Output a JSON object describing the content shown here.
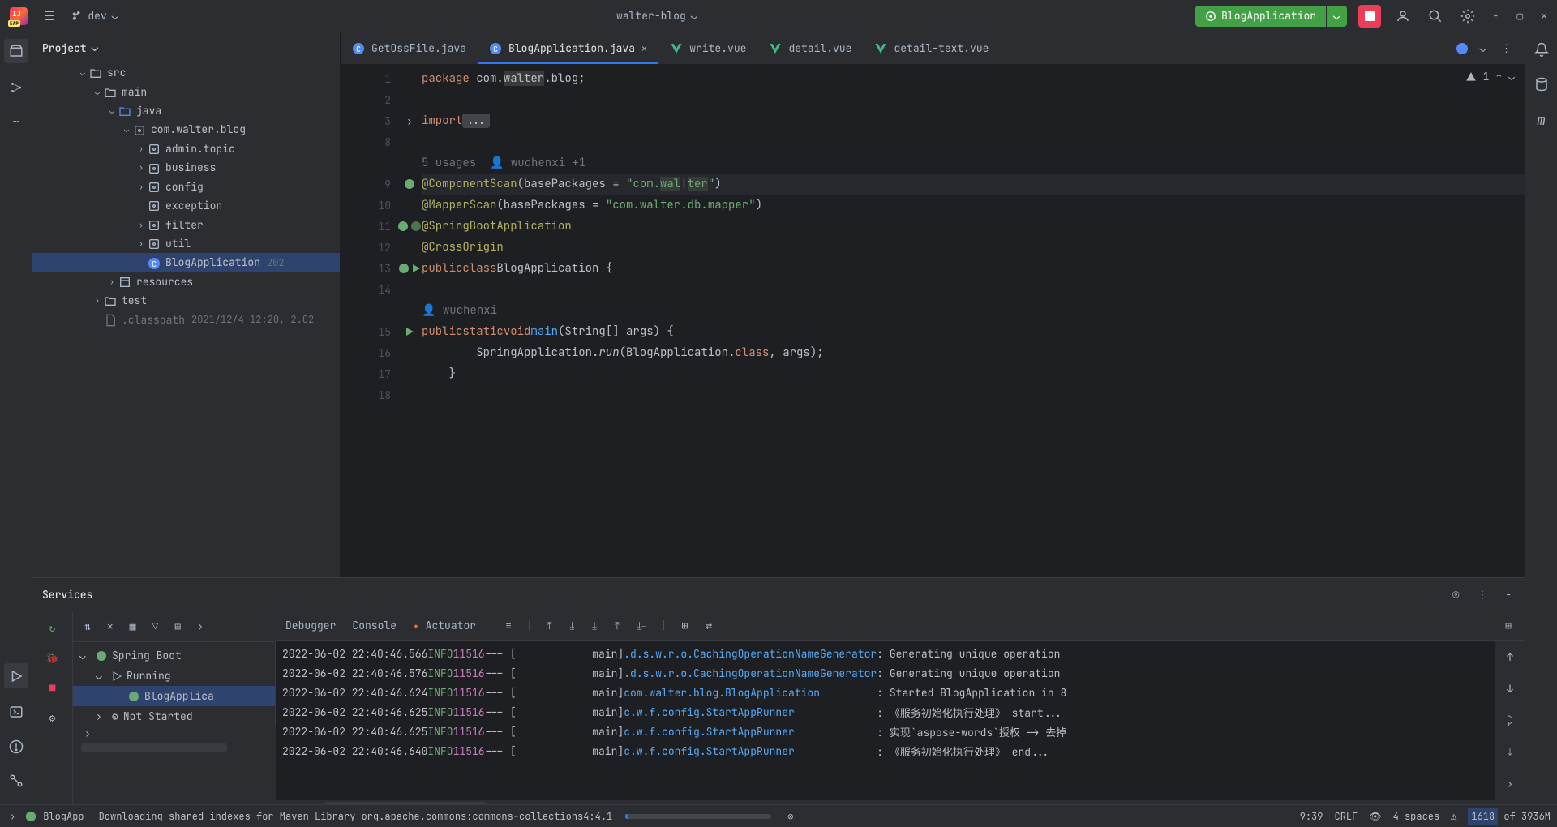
{
  "titlebar": {
    "branch": "dev",
    "project": "walter-blog",
    "run_config": "BlogApplication"
  },
  "project_panel": {
    "title": "Project",
    "tree": [
      {
        "indent": 3,
        "chevron": "v",
        "icon": "folder",
        "label": "src"
      },
      {
        "indent": 4,
        "chevron": "v",
        "icon": "folder",
        "label": "main"
      },
      {
        "indent": 5,
        "chevron": "v",
        "icon": "folder-blue",
        "label": "java"
      },
      {
        "indent": 6,
        "chevron": "v",
        "icon": "package",
        "label": "com.walter.blog"
      },
      {
        "indent": 7,
        "chevron": ">",
        "icon": "package",
        "label": "admin.topic"
      },
      {
        "indent": 7,
        "chevron": ">",
        "icon": "package",
        "label": "business"
      },
      {
        "indent": 7,
        "chevron": ">",
        "icon": "package",
        "label": "config"
      },
      {
        "indent": 7,
        "chevron": "",
        "icon": "package",
        "label": "exception"
      },
      {
        "indent": 7,
        "chevron": ">",
        "icon": "package",
        "label": "filter"
      },
      {
        "indent": 7,
        "chevron": ">",
        "icon": "package",
        "label": "util"
      },
      {
        "indent": 7,
        "chevron": "",
        "icon": "class",
        "label": "BlogApplication",
        "meta": "202",
        "selected": true
      },
      {
        "indent": 5,
        "chevron": ">",
        "icon": "resources",
        "label": "resources"
      },
      {
        "indent": 4,
        "chevron": ">",
        "icon": "folder",
        "label": "test"
      },
      {
        "indent": 4,
        "chevron": "",
        "icon": "file",
        "label": ".classpath",
        "meta": "2021/12/4 12:20, 2.02",
        "dimmed": true
      }
    ]
  },
  "tabs": [
    {
      "icon": "java",
      "label": "GetOssFile.java"
    },
    {
      "icon": "java",
      "label": "BlogApplication.java",
      "active": true,
      "closable": true
    },
    {
      "icon": "vue",
      "label": "write.vue"
    },
    {
      "icon": "vue",
      "label": "detail.vue"
    },
    {
      "icon": "vue",
      "label": "detail-text.vue"
    }
  ],
  "editor": {
    "inspection_count": "1",
    "lines": [
      {
        "num": "1",
        "html": "<span class='k-keyword'>package</span> com.<span class='highlight'>walter</span>.blog;"
      },
      {
        "num": "2",
        "html": ""
      },
      {
        "num": "3",
        "fold": ">",
        "html": "<span class='k-keyword'>import</span> <span class='k-fold'>...</span>"
      },
      {
        "num": "8",
        "html": ""
      },
      {
        "num": "",
        "html": "<span class='k-comment'>5 usages  👤 wuchenxi +1</span>"
      },
      {
        "num": "9",
        "icon": "spring",
        "caret": true,
        "html": "<span class='k-annotation'>@ComponentScan</span>(basePackages = <span class='k-string'>\"com.<span class='highlight'>wal</span>|<span class='highlight'>ter</span>\"</span>)"
      },
      {
        "num": "10",
        "html": "<span class='k-annotation'>@MapperScan</span>(basePackages = <span class='k-string'>\"com.walter.db.mapper\"</span>)"
      },
      {
        "num": "11",
        "icon": "spring2",
        "html": "<span class='k-annotation'>@SpringBootApplication</span>"
      },
      {
        "num": "12",
        "html": "<span class='k-annotation'>@CrossOrigin</span>"
      },
      {
        "num": "13",
        "icon": "run",
        "html": "<span class='k-keyword'>public</span> <span class='k-keyword'>class</span> <span class='k-class'>BlogApplication</span> {"
      },
      {
        "num": "14",
        "html": ""
      },
      {
        "num": "",
        "html": "    <span class='k-comment'>👤 wuchenxi</span>"
      },
      {
        "num": "15",
        "icon": "run-only",
        "html": "    <span class='k-keyword'>public</span> <span class='k-keyword'>static</span> <span class='k-keyword'>void</span> <span class='k-method'>main</span>(String[] args) {"
      },
      {
        "num": "16",
        "html": "        SpringApplication.<span class='k-italic'>run</span>(BlogApplication.<span class='k-keyword'>class</span>, args);"
      },
      {
        "num": "17",
        "html": "    }"
      },
      {
        "num": "18",
        "html": ""
      }
    ]
  },
  "services": {
    "title": "Services",
    "tree": [
      {
        "indent": 0,
        "chevron": "v",
        "icon": "spring",
        "label": "Spring Boot"
      },
      {
        "indent": 1,
        "chevron": "v",
        "icon": "run",
        "label": "Running"
      },
      {
        "indent": 2,
        "chevron": "",
        "icon": "app",
        "label": "BlogApplica",
        "selected": true
      },
      {
        "indent": 1,
        "chevron": ">",
        "icon": "gear",
        "label": "Not Started"
      }
    ],
    "tabs": {
      "debugger": "Debugger",
      "console": "Console",
      "actuator": "Actuator"
    },
    "console": [
      {
        "time": "2022-06-02 22:40:46.566",
        "level": "INFO",
        "pid": "11516",
        "thread": "main",
        "logger": ".d.s.w.r.o.CachingOperationNameGenerator",
        "msg": ": Generating unique operation"
      },
      {
        "time": "2022-06-02 22:40:46.576",
        "level": "INFO",
        "pid": "11516",
        "thread": "main",
        "logger": ".d.s.w.r.o.CachingOperationNameGenerator",
        "msg": ": Generating unique operation"
      },
      {
        "time": "2022-06-02 22:40:46.624",
        "level": "INFO",
        "pid": "11516",
        "thread": "main",
        "logger": "com.walter.blog.BlogApplication         ",
        "msg": ": Started BlogApplication in 8"
      },
      {
        "time": "2022-06-02 22:40:46.625",
        "level": "INFO",
        "pid": "11516",
        "thread": "main",
        "logger": "c.w.f.config.StartAppRunner             ",
        "msg": ": 《服务初始化执行处理》 start..."
      },
      {
        "time": "2022-06-02 22:40:46.625",
        "level": "INFO",
        "pid": "11516",
        "thread": "main",
        "logger": "c.w.f.config.StartAppRunner             ",
        "msg": ": 实现`aspose-words`授权 -> 去掉"
      },
      {
        "time": "2022-06-02 22:40:46.640",
        "level": "INFO",
        "pid": "11516",
        "thread": "main",
        "logger": "c.w.f.config.StartAppRunner             ",
        "msg": ": 《服务初始化执行处理》 end..."
      }
    ]
  },
  "statusbar": {
    "app_icon_label": "BlogApp",
    "task": "Downloading shared indexes for Maven Library org.apache.commons:commons-collections4:4.1",
    "time": "9:39",
    "encoding": "CRLF",
    "indent": "4 spaces",
    "memory": "1618",
    "memory_total": "of 3936M"
  }
}
